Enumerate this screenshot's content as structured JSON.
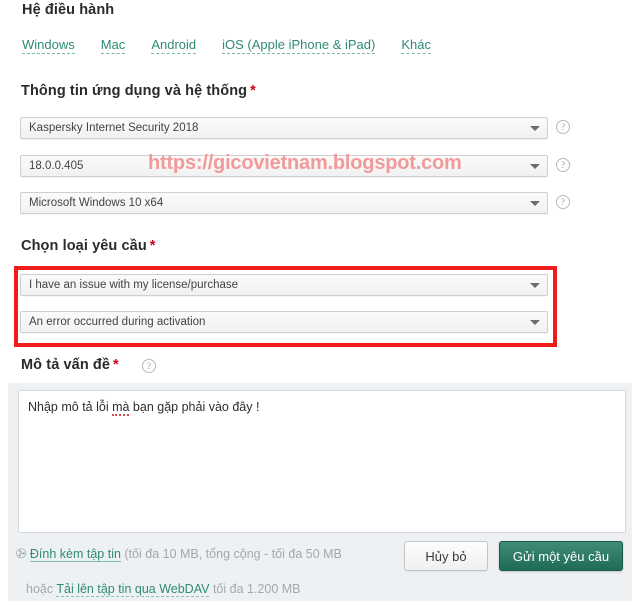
{
  "os_section": {
    "title": "Hệ điều hành",
    "tabs": [
      {
        "label": "Windows"
      },
      {
        "label": "Mac"
      },
      {
        "label": "Android"
      },
      {
        "label": "iOS (Apple iPhone & iPad)"
      },
      {
        "label": "Khác"
      }
    ]
  },
  "app_section": {
    "title": "Thông tin ứng dụng và hệ thống",
    "required_mark": "*",
    "selects": [
      {
        "value": "Kaspersky Internet Security 2018",
        "help": "?"
      },
      {
        "value": "18.0.0.405",
        "help": "?"
      },
      {
        "value": "Microsoft Windows 10 x64",
        "help": "?"
      }
    ]
  },
  "watermark": {
    "text": "https://gicovietnam.blogspot.com",
    "color": "#f19a9a"
  },
  "request_section": {
    "title": "Chọn loại yêu cầu",
    "required_mark": "*",
    "highlight_color": "#ef1c1c",
    "selects": [
      {
        "value": "I have an issue with my license/purchase"
      },
      {
        "value": "An error occurred during activation"
      }
    ]
  },
  "description_section": {
    "title": "Mô tả vấn đề",
    "required_mark": "*",
    "help": "?",
    "text_before": "Nhập mô tả lỗi ",
    "text_misspelled": "mà",
    "text_after": " bạn gặp phải vào đây !"
  },
  "footer": {
    "clip_icon": "✇",
    "attach_link": "Đính kèm tập tin",
    "attach_note": "(tối đa 10 MB, tổng cộng - tối đa 50 MB",
    "webdav_prefix": "hoặc ",
    "webdav_link": "Tải lên tập tin qua WebDAV",
    "webdav_suffix": " tối đa 1.200 MB",
    "cancel_label": "Hủy bỏ",
    "submit_label": "Gửi một yêu cầu",
    "submit_color": "#2a7a66"
  }
}
